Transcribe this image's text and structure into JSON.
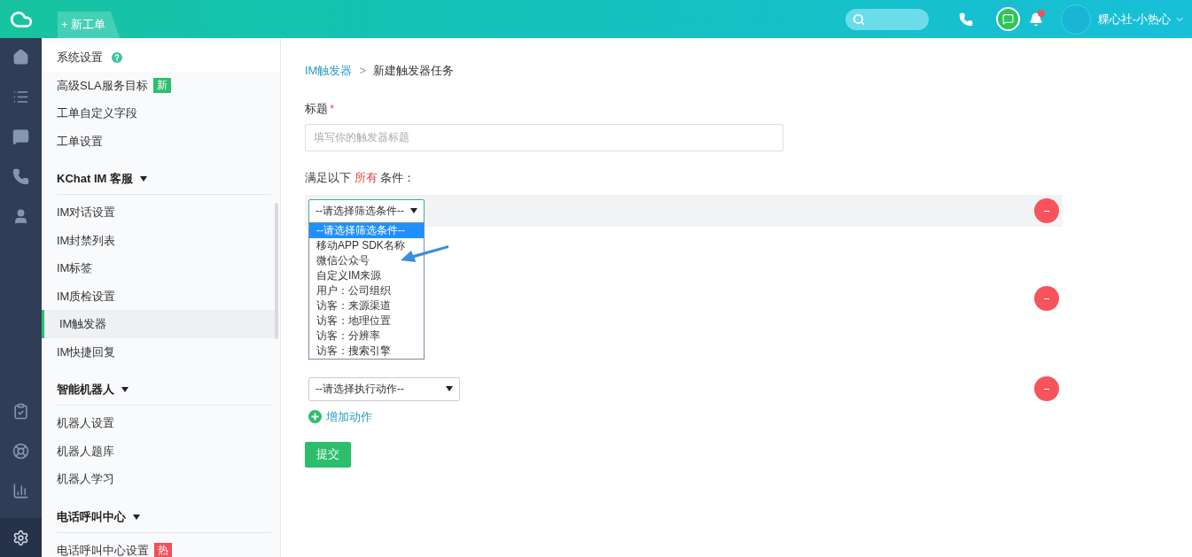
{
  "header": {
    "new_ticket": "+ 新工单",
    "user_name": "粿心社-小热心",
    "has_notification": true
  },
  "sidebar": {
    "sections": [
      {
        "items": [
          {
            "label": "系统设置",
            "help": true,
            "selected": false
          },
          {
            "label": "高级SLA服务目标",
            "badge": "新",
            "color": "#2dbe6c",
            "selected": false
          },
          {
            "label": "工单自定义字段",
            "selected": false
          },
          {
            "label": "工单设置",
            "selected": false
          }
        ]
      },
      {
        "title": "KChat IM 客服",
        "items": [
          {
            "label": "IM对话设置",
            "selected": false
          },
          {
            "label": "IM封禁列表",
            "selected": false
          },
          {
            "label": "IM标签",
            "selected": false
          },
          {
            "label": "IM质检设置",
            "selected": false
          },
          {
            "label": "IM触发器",
            "selected": true
          },
          {
            "label": "IM快捷回复",
            "selected": false
          }
        ]
      },
      {
        "title": "智能机器人",
        "items": [
          {
            "label": "机器人设置",
            "selected": false
          },
          {
            "label": "机器人题库",
            "selected": false
          },
          {
            "label": "机器人学习",
            "selected": false
          }
        ]
      },
      {
        "title": "电话呼叫中心",
        "items": [
          {
            "label": "电话呼叫中心设置",
            "badge": "热",
            "color": "#f0505a",
            "selected": false
          }
        ]
      }
    ]
  },
  "breadcrumb": {
    "parent": "IM触发器",
    "separator": ">",
    "current": "新建触发器任务"
  },
  "title_field": {
    "label": "标题",
    "required_mark": "*",
    "placeholder": "填写你的触发器标题"
  },
  "conditions": {
    "label_prefix": "满足以下",
    "label_highlight": "所有",
    "label_suffix": "条件：",
    "rows": [
      {
        "select": "--请选择筛选条件--",
        "expanded": true,
        "options": [
          {
            "label": "--请选择筛选条件--",
            "selected": true
          },
          {
            "label": "移动APP SDK名称",
            "selected": false
          },
          {
            "label": "微信公众号",
            "selected": false
          },
          {
            "label": "自定义IM来源",
            "selected": false
          },
          {
            "label": "用户：公司组织",
            "selected": false
          },
          {
            "label": "访客：来源渠道",
            "selected": false
          },
          {
            "label": "访客：地理位置",
            "selected": false
          },
          {
            "label": "访客：分辨率",
            "selected": false
          },
          {
            "label": "访客：搜索引擎",
            "selected": false
          }
        ]
      }
    ]
  },
  "actions": {
    "rows": [
      {
        "select": "--请选择执行动作--"
      }
    ],
    "add_label": "增加动作"
  },
  "submit": "提交"
}
